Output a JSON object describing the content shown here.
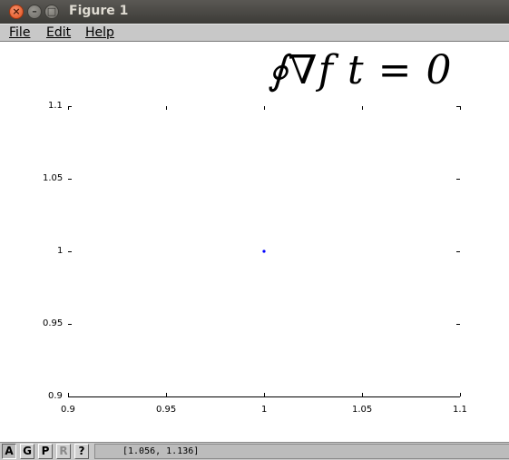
{
  "window": {
    "title": "Figure 1",
    "close_glyph": "×",
    "minimize_glyph": "–",
    "maximize_glyph": "□"
  },
  "menu": {
    "file": "File",
    "edit": "Edit",
    "help": "Help"
  },
  "plot": {
    "annotation": "∮∇f t = 0",
    "point_color": "#0000ff"
  },
  "chart_data": {
    "type": "scatter",
    "title": "",
    "xlabel": "",
    "ylabel": "",
    "xlim": [
      0.9,
      1.1
    ],
    "ylim": [
      0.9,
      1.1
    ],
    "x_ticks": [
      "0.9",
      "0.95",
      "1",
      "1.05",
      "1.1"
    ],
    "y_ticks": [
      "1.1",
      "1.05",
      "1",
      "0.95",
      "0.9"
    ],
    "series": [
      {
        "x": [
          1.0
        ],
        "y": [
          1.0
        ],
        "color": "#0000ff"
      }
    ],
    "grid": false
  },
  "statusbar": {
    "buttons": [
      "A",
      "G",
      "P",
      "R",
      "?"
    ],
    "coordinates": "[1.056, 1.136]"
  }
}
